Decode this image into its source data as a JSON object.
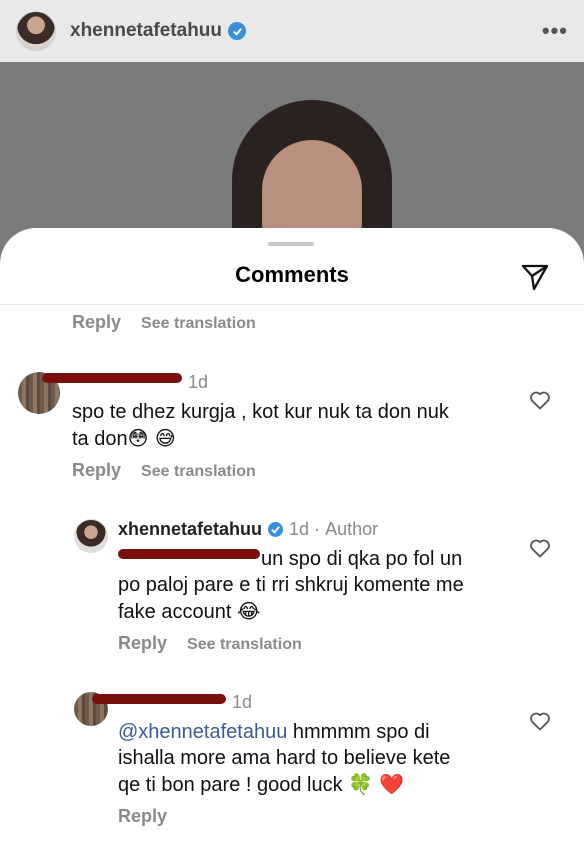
{
  "post": {
    "username": "xhennetafetahuu",
    "more_label": "•••"
  },
  "sheet": {
    "title": "Comments"
  },
  "top_reply": {
    "reply_label": "Reply",
    "translate_label": "See translation"
  },
  "comments": [
    {
      "time": "1d",
      "text_line1": "spo te dhez kurgja , kot kur nuk ta don nuk",
      "text_line2": "ta don",
      "emoji": "😳 😅",
      "reply_label": "Reply",
      "translate_label": "See translation"
    },
    {
      "username": "xhennetafetahuu",
      "time": "1d",
      "separator": "·",
      "author_label": "Author",
      "text_line1": "un spo di qka po fol un",
      "text_line2": "po paloj pare e ti rri shkruj komente me",
      "text_line3": "fake account",
      "emoji": "😂",
      "reply_label": "Reply",
      "translate_label": "See translation"
    },
    {
      "time": "1d",
      "mention": "@xhennetafetahuu",
      "text_line1": " hmmmm spo  di",
      "text_line2": "ishalla more ama hard  to believe kete",
      "text_line3": "qe ti bon pare ! good luck",
      "emoji": "🍀 ❤️",
      "reply_label": "Reply"
    }
  ],
  "colors": {
    "link_gray": "#8a8a8a",
    "mention_blue": "#3b5a9a",
    "verified_blue": "#3a8fd6",
    "redaction": "#7a0f0f"
  }
}
